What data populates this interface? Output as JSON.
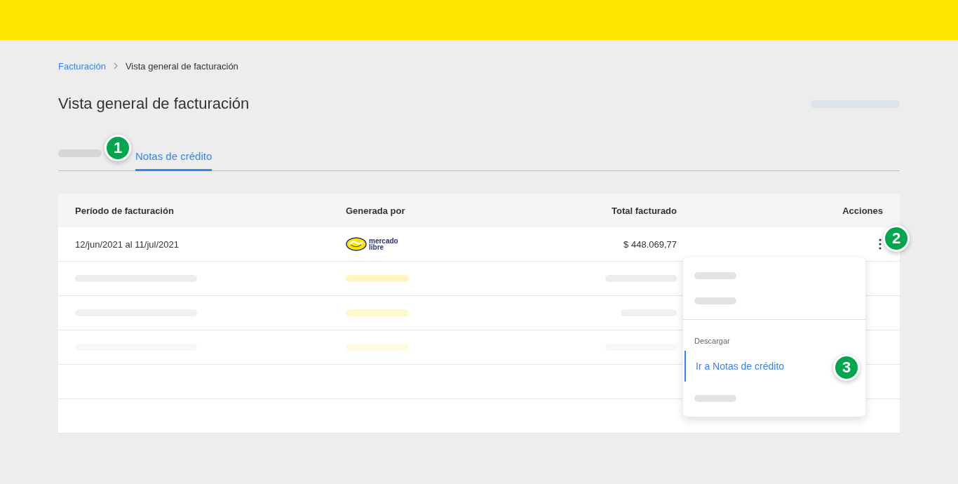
{
  "breadcrumb": {
    "items": [
      {
        "label": "Facturación",
        "kind": "link"
      },
      {
        "label": "Vista general de facturación",
        "kind": "current"
      }
    ]
  },
  "page_title": "Vista general de facturación",
  "tabs": [
    {
      "kind": "skeleton",
      "selected": false
    },
    {
      "kind": "text",
      "label": "Notas de crédito",
      "selected": true,
      "marker": "1"
    }
  ],
  "table": {
    "columns": [
      "Período de facturación",
      "Generada por",
      "Total facturado",
      "Acciones"
    ],
    "rows": [
      {
        "kind": "data",
        "period": "12/jun/2021 al 11/jul/2021",
        "generated_by": [
          "mercado",
          "libre"
        ],
        "total": "$ 448.069,77",
        "marker": "2"
      },
      {
        "kind": "skeleton"
      },
      {
        "kind": "skeleton"
      },
      {
        "kind": "skeleton"
      },
      {
        "kind": "empty"
      },
      {
        "kind": "empty"
      }
    ]
  },
  "actions_menu": {
    "items": [
      {
        "kind": "skeleton"
      },
      {
        "kind": "skeleton"
      },
      {
        "kind": "divider"
      },
      {
        "kind": "header",
        "label": "Descargar"
      },
      {
        "kind": "link",
        "label": "Ir a Notas de crédito",
        "selected": true,
        "marker": "3"
      },
      {
        "kind": "skeleton"
      }
    ]
  }
}
